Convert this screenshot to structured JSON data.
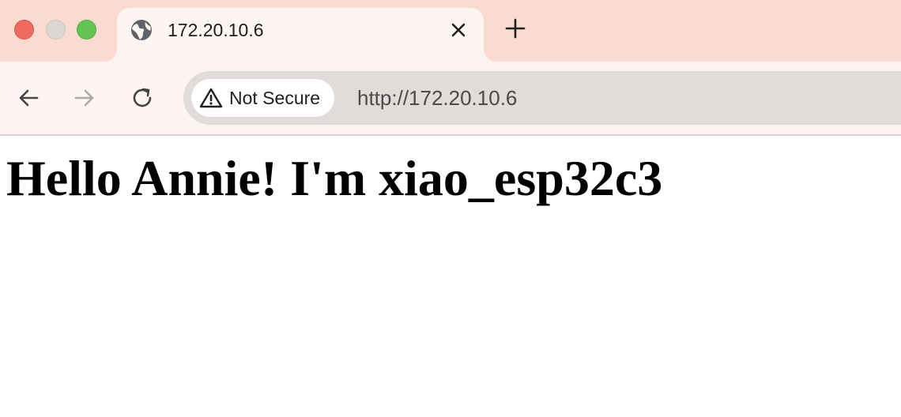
{
  "window": {
    "controls": {
      "close_icon": "close-circle",
      "minimize_icon": "minimize-circle",
      "maximize_icon": "maximize-circle"
    }
  },
  "tab": {
    "title": "172.20.10.6",
    "favicon": "globe-icon",
    "close_icon": "close-icon"
  },
  "new_tab_icon": "plus-icon",
  "toolbar": {
    "back_icon": "arrow-left-icon",
    "forward_icon": "arrow-right-icon",
    "reload_icon": "reload-icon",
    "security_label": "Not Secure",
    "security_icon": "warning-triangle-icon",
    "url": "http://172.20.10.6"
  },
  "page": {
    "heading": "Hello Annie! I'm xiao_esp32c3"
  },
  "colors": {
    "tabstrip_bg": "#f9dccf",
    "toolbar_bg": "#fdf5f1",
    "omnibox_bg": "#e1dbda",
    "close_red": "#ee6a5f",
    "maximize_green": "#62c554"
  }
}
